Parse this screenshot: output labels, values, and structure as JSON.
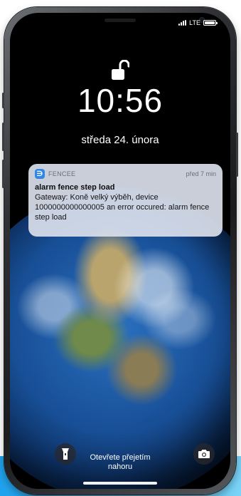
{
  "status_bar": {
    "carrier_type": "LTE",
    "battery_icon": "battery-icon",
    "signal_icon": "signal-icon"
  },
  "lock_screen": {
    "lock_icon": "unlock-icon",
    "time": "10:56",
    "date": "středa 24. února"
  },
  "notification": {
    "app_icon": "fencee-app-icon",
    "app_icon_glyph": "∋",
    "app_name": "FENCEE",
    "time": "před 7 min",
    "title": "alarm fence step load",
    "body": "Gateway: Koně velký výběh, device 1000000000000005 an error occured: alarm fence step load"
  },
  "bottom": {
    "flashlight_icon": "flashlight-icon",
    "camera_icon": "camera-icon",
    "swipe_line1": "Otevřete přejetím",
    "swipe_line2": "nahoru"
  },
  "colors": {
    "accent_bar": "#1fa3ee",
    "notification_bg": "#dae0ec",
    "app_icon_bg": "#2f88e8"
  }
}
